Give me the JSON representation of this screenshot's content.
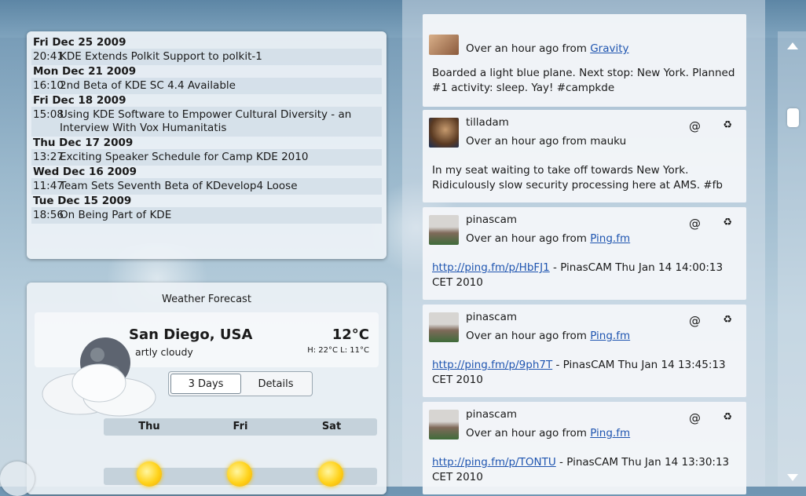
{
  "news": {
    "groups": [
      {
        "date": "Fri Dec 25 2009",
        "items": [
          {
            "time": "20:41",
            "headline": "KDE Extends Polkit Support to polkit-1"
          }
        ]
      },
      {
        "date": "Mon Dec 21 2009",
        "items": [
          {
            "time": "16:10",
            "headline": "2nd Beta of KDE SC 4.4 Available"
          }
        ]
      },
      {
        "date": "Fri Dec 18 2009",
        "items": [
          {
            "time": "15:08",
            "headline": "Using KDE Software to Empower Cultural Diversity - an Interview With Vox Humanitatis"
          }
        ]
      },
      {
        "date": "Thu Dec 17 2009",
        "items": [
          {
            "time": "13:27",
            "headline": "Exciting Speaker Schedule for Camp KDE 2010"
          }
        ]
      },
      {
        "date": "Wed Dec 16 2009",
        "items": [
          {
            "time": "11:47",
            "headline": "Team Sets Seventh Beta of KDevelop4 Loose"
          }
        ]
      },
      {
        "date": "Tue Dec 15 2009",
        "items": [
          {
            "time": "18:56",
            "headline": "On Being Part of KDE"
          }
        ]
      }
    ]
  },
  "weather": {
    "title": "Weather Forecast",
    "city": "San Diego, USA",
    "condition": "artly cloudy",
    "temperature": "12°C",
    "high_low": "H: 22°C L: 11°C",
    "tabs": [
      "3 Days",
      "Details"
    ],
    "days": [
      "Thu",
      "Fri",
      "Sat"
    ],
    "day_icons": [
      "sun-icon",
      "sun-icon",
      "sun-icon"
    ]
  },
  "tweets": [
    {
      "user": "",
      "time_prefix": "Over an hour ago from ",
      "source": "Gravity",
      "source_is_link": true,
      "link": "",
      "text": "Boarded a light blue plane. Next stop: New York. Planned #1 activity: sleep. Yay! #campkde"
    },
    {
      "user": "tilladam",
      "time_prefix": "Over an hour ago from ",
      "source": "mauku",
      "source_is_link": false,
      "link": "",
      "text": "In my seat waiting to take off towards New York. Ridiculously slow security processing here at AMS. #fb"
    },
    {
      "user": "pinascam",
      "time_prefix": "Over an hour ago from ",
      "source": "Ping.fm",
      "source_is_link": true,
      "link": "http://ping.fm/p/HbFJ1",
      "text": " - PinasCAM Thu Jan 14 14:00:13 CET 2010"
    },
    {
      "user": "pinascam",
      "time_prefix": "Over an hour ago from ",
      "source": "Ping.fm",
      "source_is_link": true,
      "link": "http://ping.fm/p/9ph7T",
      "text": " - PinasCAM Thu Jan 14 13:45:13 CET 2010"
    },
    {
      "user": "pinascam",
      "time_prefix": "Over an hour ago from ",
      "source": "Ping.fm",
      "source_is_link": true,
      "link": "http://ping.fm/p/TONTU",
      "text": " - PinasCAM Thu Jan 14 13:30:13 CET 2010"
    }
  ],
  "tweet_actions": {
    "reply": "@",
    "retweet": "♻"
  },
  "colors": {
    "link": "#1f55b0",
    "sun": "#ffd21a"
  }
}
